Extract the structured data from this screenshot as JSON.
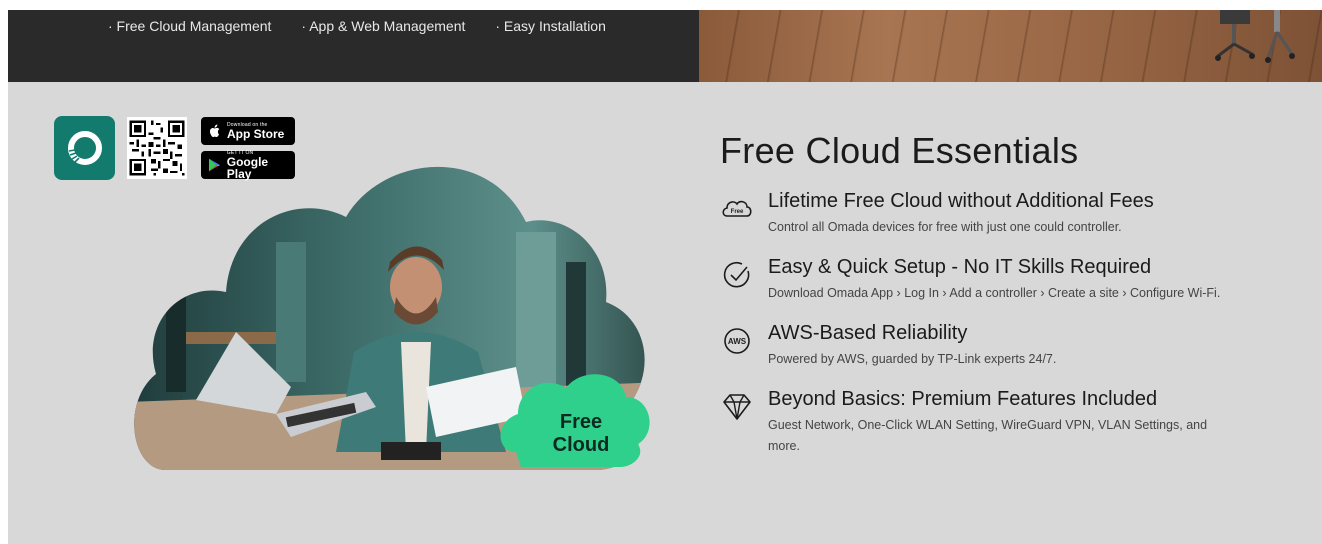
{
  "top_banner": {
    "features": [
      "· Free Cloud Management",
      "· App & Web Management",
      "· Easy Installation"
    ]
  },
  "app_store": {
    "app_store_small": "Download on the",
    "app_store_big": "App Store",
    "google_play_small": "GET IT ON",
    "google_play_big": "Google Play"
  },
  "hero": {
    "badge_line1": "Free",
    "badge_line2": "Cloud"
  },
  "essentials": {
    "title": "Free Cloud Essentials",
    "items": [
      {
        "icon": "free-cloud-icon",
        "title": "Lifetime Free Cloud without Additional Fees",
        "desc": "Control all Omada devices for free with just one could controller."
      },
      {
        "icon": "check-circle-icon",
        "title": "Easy & Quick Setup - No IT Skills Required",
        "desc": "Download Omada App › Log In › Add a controller › Create a site › Configure Wi-Fi."
      },
      {
        "icon": "aws-icon",
        "title": "AWS-Based Reliability",
        "desc": "Powered by AWS, guarded by TP-Link experts 24/7."
      },
      {
        "icon": "diamond-icon",
        "title": "Beyond Basics: Premium Features Included",
        "desc": "Guest Network, One-Click WLAN Setting, WireGuard VPN, VLAN Settings, and more."
      }
    ]
  },
  "colors": {
    "accent": "#137a6e",
    "badge_green": "#2fd08b",
    "dark_banner": "#2a2a2a",
    "section_bg": "#d8d8d8"
  }
}
